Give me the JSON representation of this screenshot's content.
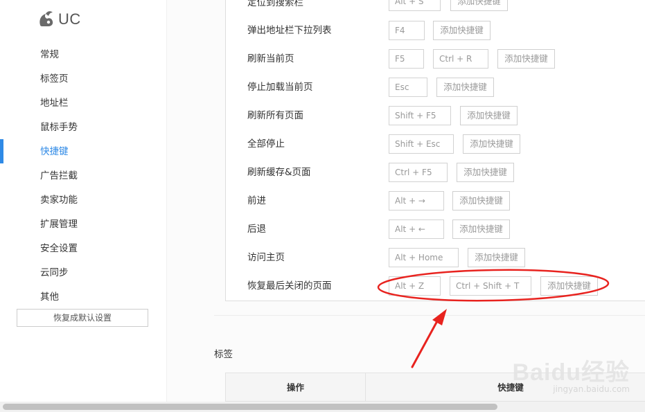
{
  "sidebar": {
    "logo_text": "UC",
    "items": [
      {
        "label": "常规"
      },
      {
        "label": "标签页"
      },
      {
        "label": "地址栏"
      },
      {
        "label": "鼠标手势"
      },
      {
        "label": "快捷键"
      },
      {
        "label": "广告拦截"
      },
      {
        "label": "卖家功能"
      },
      {
        "label": "扩展管理"
      },
      {
        "label": "安全设置"
      },
      {
        "label": "云同步"
      },
      {
        "label": "其他"
      }
    ],
    "active_index": 4,
    "reset_label": "恢复成默认设置"
  },
  "shortcuts": {
    "add_label": "添加快捷键",
    "rows": [
      {
        "label": "定位到搜索栏",
        "keys": [
          "Alt + S"
        ]
      },
      {
        "label": "弹出地址栏下拉列表",
        "keys": [
          "F4"
        ]
      },
      {
        "label": "刷新当前页",
        "keys": [
          "F5",
          "Ctrl + R"
        ]
      },
      {
        "label": "停止加载当前页",
        "keys": [
          "Esc"
        ]
      },
      {
        "label": "刷新所有页面",
        "keys": [
          "Shift + F5"
        ]
      },
      {
        "label": "全部停止",
        "keys": [
          "Shift + Esc"
        ]
      },
      {
        "label": "刷新缓存&页面",
        "keys": [
          "Ctrl + F5"
        ]
      },
      {
        "label": "前进",
        "keys": [
          "Alt + →"
        ]
      },
      {
        "label": "后退",
        "keys": [
          "Alt + ←"
        ]
      },
      {
        "label": "访问主页",
        "keys": [
          "Alt + Home"
        ]
      },
      {
        "label": "恢复最后关闭的页面",
        "keys": [
          "Alt + Z",
          "Ctrl + Shift + T"
        ]
      }
    ]
  },
  "tabs_section": {
    "title": "标签",
    "columns": [
      "操作",
      "快捷键"
    ]
  },
  "annotation": {
    "color": "#e8231f"
  },
  "watermark": {
    "logo": "Baidu经验",
    "url": "jingyan.baidu.com"
  },
  "colors": {
    "accent": "#2f8ae6",
    "annotation": "#e8231f"
  }
}
